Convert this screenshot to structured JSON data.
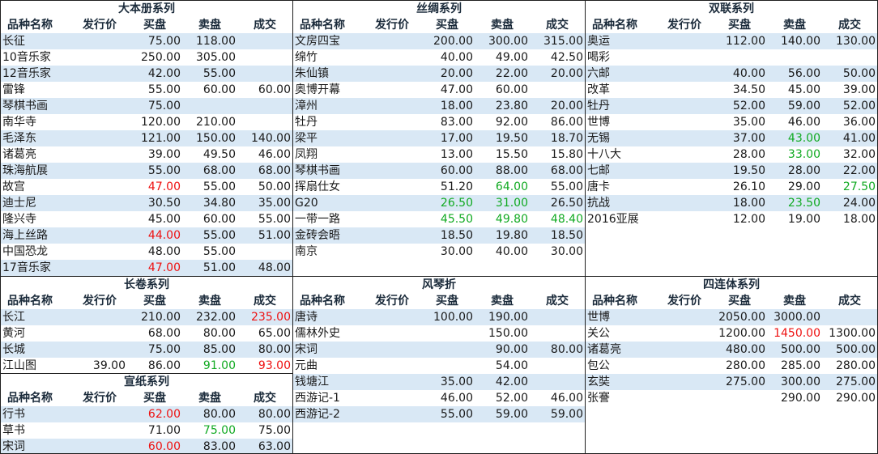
{
  "colors": {
    "band": "#d9e8f5",
    "red": "#ee1111",
    "green": "#11aa22",
    "border": "#1f1f1f"
  },
  "header": [
    "品种名称",
    "发行价",
    "买盘",
    "卖盘",
    "成交"
  ],
  "panels": [
    {
      "id": "daben",
      "title": "大本册系列",
      "rows": [
        {
          "name": "长征",
          "issue": "",
          "buy": "75.00",
          "sell": "118.00",
          "deal": ""
        },
        {
          "name": "10音乐家",
          "issue": "",
          "buy": "250.00",
          "sell": "305.00",
          "deal": ""
        },
        {
          "name": "12音乐家",
          "issue": "",
          "buy": "42.00",
          "sell": "55.00",
          "deal": ""
        },
        {
          "name": "雷锋",
          "issue": "",
          "buy": "55.00",
          "sell": "60.00",
          "deal": "60.00"
        },
        {
          "name": "琴棋书画",
          "issue": "",
          "buy": "75.00",
          "sell": "",
          "deal": ""
        },
        {
          "name": "南华寺",
          "issue": "",
          "buy": "120.00",
          "sell": "210.00",
          "deal": ""
        },
        {
          "name": "毛泽东",
          "issue": "",
          "buy": "121.00",
          "sell": "150.00",
          "deal": "140.00"
        },
        {
          "name": "诸葛亮",
          "issue": "",
          "buy": "39.00",
          "sell": "49.50",
          "deal": "46.00"
        },
        {
          "name": "珠海航展",
          "issue": "",
          "buy": "55.00",
          "sell": "68.00",
          "deal": "68.00"
        },
        {
          "name": "故宫",
          "issue": "",
          "buy": "47.00",
          "sell": "55.00",
          "deal": "50.00",
          "buy_color": "red"
        },
        {
          "name": "迪士尼",
          "issue": "",
          "buy": "30.50",
          "sell": "34.80",
          "deal": "35.00"
        },
        {
          "name": "隆兴寺",
          "issue": "",
          "buy": "45.00",
          "sell": "60.00",
          "deal": "55.00"
        },
        {
          "name": "海上丝路",
          "issue": "",
          "buy": "44.00",
          "sell": "55.00",
          "deal": "51.00",
          "buy_color": "red"
        },
        {
          "name": "中国恐龙",
          "issue": "",
          "buy": "48.00",
          "sell": "55.00",
          "deal": ""
        },
        {
          "name": "17音乐家",
          "issue": "",
          "buy": "47.00",
          "sell": "51.00",
          "deal": "48.00",
          "buy_color": "red"
        }
      ]
    },
    {
      "id": "sichou",
      "title": "丝绸系列",
      "rows": [
        {
          "name": "文房四宝",
          "issue": "",
          "buy": "200.00",
          "sell": "300.00",
          "deal": "315.00"
        },
        {
          "name": "绵竹",
          "issue": "",
          "buy": "40.00",
          "sell": "49.00",
          "deal": "42.50"
        },
        {
          "name": "朱仙镇",
          "issue": "",
          "buy": "20.00",
          "sell": "22.00",
          "deal": "20.00"
        },
        {
          "name": "奥博开幕",
          "issue": "",
          "buy": "47.00",
          "sell": "60.00",
          "deal": ""
        },
        {
          "name": "漳州",
          "issue": "",
          "buy": "18.00",
          "sell": "23.80",
          "deal": "20.00"
        },
        {
          "name": "牡丹",
          "issue": "",
          "buy": "83.00",
          "sell": "92.00",
          "deal": "86.00"
        },
        {
          "name": "梁平",
          "issue": "",
          "buy": "17.00",
          "sell": "19.50",
          "deal": "18.70"
        },
        {
          "name": "凤翔",
          "issue": "",
          "buy": "13.00",
          "sell": "15.50",
          "deal": "15.80"
        },
        {
          "name": "琴棋书画",
          "issue": "",
          "buy": "60.00",
          "sell": "88.00",
          "deal": "68.00"
        },
        {
          "name": "挥扇仕女",
          "issue": "",
          "buy": "51.20",
          "sell": "64.00",
          "deal": "55.00",
          "sell_color": "green"
        },
        {
          "name": "G20",
          "issue": "",
          "buy": "26.50",
          "sell": "31.00",
          "deal": "26.50",
          "buy_color": "green",
          "sell_color": "green"
        },
        {
          "name": "一带一路",
          "issue": "",
          "buy": "45.50",
          "sell": "49.80",
          "deal": "48.40",
          "buy_color": "green",
          "sell_color": "green",
          "deal_color": "green"
        },
        {
          "name": "金砖会晤",
          "issue": "",
          "buy": "18.50",
          "sell": "19.80",
          "deal": "18.50"
        },
        {
          "name": "南京",
          "issue": "",
          "buy": "30.00",
          "sell": "40.00",
          "deal": "30.00"
        }
      ]
    },
    {
      "id": "shuanglian",
      "title": "双联系列",
      "rows": [
        {
          "name": "奥运",
          "issue": "",
          "buy": "112.00",
          "sell": "140.00",
          "deal": "130.00"
        },
        {
          "name": "喝彩",
          "issue": "",
          "buy": "",
          "sell": "",
          "deal": ""
        },
        {
          "name": "六邮",
          "issue": "",
          "buy": "40.00",
          "sell": "56.00",
          "deal": "50.00"
        },
        {
          "name": "改革",
          "issue": "",
          "buy": "34.50",
          "sell": "45.00",
          "deal": "39.00"
        },
        {
          "name": "牡丹",
          "issue": "",
          "buy": "52.00",
          "sell": "59.00",
          "deal": "52.00"
        },
        {
          "name": "世博",
          "issue": "",
          "buy": "35.00",
          "sell": "46.00",
          "deal": "36.00"
        },
        {
          "name": "无锡",
          "issue": "",
          "buy": "37.00",
          "sell": "43.00",
          "deal": "41.00",
          "sell_color": "green"
        },
        {
          "name": "十八大",
          "issue": "",
          "buy": "28.00",
          "sell": "33.00",
          "deal": "32.00",
          "sell_color": "green"
        },
        {
          "name": "七邮",
          "issue": "",
          "buy": "19.50",
          "sell": "28.00",
          "deal": "22.00"
        },
        {
          "name": "唐卡",
          "issue": "",
          "buy": "26.10",
          "sell": "29.00",
          "deal": "27.50",
          "deal_color": "green"
        },
        {
          "name": "抗战",
          "issue": "",
          "buy": "18.00",
          "sell": "23.50",
          "deal": "24.00",
          "sell_color": "green"
        },
        {
          "name": "2016亚展",
          "issue": "",
          "buy": "12.00",
          "sell": "19.00",
          "deal": "18.00"
        }
      ]
    },
    {
      "id": "changjuan",
      "title": "长卷系列",
      "rows": [
        {
          "name": "长江",
          "issue": "",
          "buy": "210.00",
          "sell": "232.00",
          "deal": "235.00",
          "deal_color": "red"
        },
        {
          "name": "黄河",
          "issue": "",
          "buy": "68.00",
          "sell": "80.00",
          "deal": "65.00"
        },
        {
          "name": "长城",
          "issue": "",
          "buy": "75.00",
          "sell": "85.00",
          "deal": "80.00"
        },
        {
          "name": "江山图",
          "issue": "39.00",
          "buy": "86.00",
          "sell": "91.00",
          "deal": "93.00",
          "sell_color": "green",
          "deal_color": "red"
        }
      ]
    },
    {
      "id": "xuanzhi",
      "title": "宣纸系列",
      "rows": [
        {
          "name": "行书",
          "issue": "",
          "buy": "62.00",
          "sell": "80.00",
          "deal": "80.00",
          "buy_color": "red"
        },
        {
          "name": "草书",
          "issue": "",
          "buy": "71.00",
          "sell": "75.00",
          "deal": "75.00",
          "sell_color": "green"
        },
        {
          "name": "宋词",
          "issue": "",
          "buy": "60.00",
          "sell": "83.00",
          "deal": "63.00",
          "buy_color": "red"
        }
      ]
    },
    {
      "id": "fengqinzhe",
      "title": "风琴折",
      "rows": [
        {
          "name": "唐诗",
          "issue": "",
          "buy": "100.00",
          "sell": "190.00",
          "deal": ""
        },
        {
          "name": "儒林外史",
          "issue": "",
          "buy": "",
          "sell": "150.00",
          "deal": ""
        },
        {
          "name": "宋词",
          "issue": "",
          "buy": "",
          "sell": "90.00",
          "deal": "80.00"
        },
        {
          "name": "元曲",
          "issue": "",
          "buy": "",
          "sell": "54.00",
          "deal": ""
        },
        {
          "name": "钱塘江",
          "issue": "",
          "buy": "35.00",
          "sell": "42.00",
          "deal": ""
        },
        {
          "name": "西游记-1",
          "issue": "",
          "buy": "46.00",
          "sell": "52.00",
          "deal": "46.00"
        },
        {
          "name": "西游记-2",
          "issue": "",
          "buy": "55.00",
          "sell": "59.00",
          "deal": "59.00"
        }
      ]
    },
    {
      "id": "silianti",
      "title": "四连体系列",
      "rows": [
        {
          "name": "世博",
          "issue": "",
          "buy": "2050.00",
          "sell": "3000.00",
          "deal": ""
        },
        {
          "name": "关公",
          "issue": "",
          "buy": "1200.00",
          "sell": "1450.00",
          "deal": "1300.00",
          "sell_color": "red"
        },
        {
          "name": "诸葛亮",
          "issue": "",
          "buy": "480.00",
          "sell": "500.00",
          "deal": "500.00"
        },
        {
          "name": "包公",
          "issue": "",
          "buy": "280.00",
          "sell": "285.00",
          "deal": "280.00"
        },
        {
          "name": "玄奘",
          "issue": "",
          "buy": "275.00",
          "sell": "300.00",
          "deal": "275.00"
        },
        {
          "name": "张謇",
          "issue": "",
          "buy": "",
          "sell": "290.00",
          "deal": "290.00"
        }
      ]
    }
  ]
}
